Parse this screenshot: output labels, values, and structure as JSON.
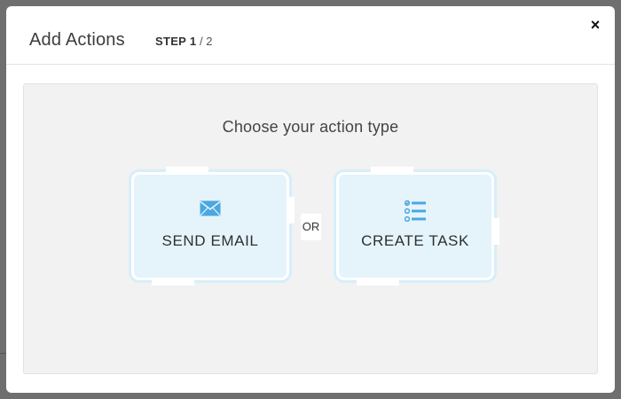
{
  "modal": {
    "title": "Add Actions",
    "step_label": "STEP 1",
    "step_total": " / 2",
    "close_glyph": "×"
  },
  "body": {
    "prompt": "Choose your action type",
    "or_label": "OR",
    "options": [
      {
        "label": "SEND EMAIL",
        "icon": "envelope-icon"
      },
      {
        "label": "CREATE TASK",
        "icon": "task-list-icon"
      }
    ]
  },
  "colors": {
    "accent": "#4aa8e0",
    "card_bg": "#e5f4fb",
    "body_bg": "#f2f2f2"
  }
}
